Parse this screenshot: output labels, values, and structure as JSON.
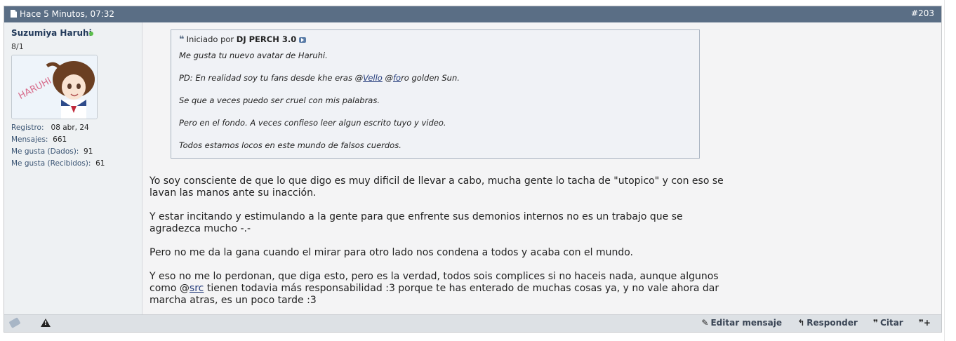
{
  "post": {
    "date": "Hace 5 Minutos, 07:32",
    "number": "#203"
  },
  "user": {
    "name": "Suzumiya Haruhi",
    "title": "8/1",
    "avatar_text": "HARUHI",
    "stats": [
      {
        "label": "Registro:",
        "value": "08 abr, 24"
      },
      {
        "label": "Mensajes:",
        "value": "661"
      },
      {
        "label": "Me gusta (Dados):",
        "value": "91"
      },
      {
        "label": "Me gusta (Recibidos):",
        "value": "61"
      }
    ]
  },
  "quote": {
    "intro": "Iniciado por",
    "author": "DJ PERCH 3.0",
    "line1": "Me gusta tu nuevo avatar de Haruhi.",
    "line2_pre": "PD: En realidad soy tu fans desde khe eras @",
    "line2_link1": "Vello",
    "line2_mid": " @",
    "line2_link2": "fo",
    "line2_link2_tail": "ro",
    "line2_post": " golden Sun.",
    "line3": "Se que a veces puedo ser cruel con mis palabras.",
    "line4": "Pero en el fondo. A veces confieso leer algun escrito tuyo y video.",
    "line5": "Todos estamos locos en este mundo de falsos cuerdos."
  },
  "message": {
    "p1": "Yo soy consciente de que lo que digo es muy dificil de llevar a cabo, mucha gente lo tacha de \"utopico\" y con eso se lavan las manos ante su inacción.",
    "p2": "Y estar incitando y estimulando a la gente para que enfrente sus demonios internos no es un trabajo que se agradezca mucho -.-",
    "p3": "Pero no me da la gana cuando el mirar para otro lado nos condena a todos y acaba con el mundo.",
    "p4_pre": "Y eso no me lo perdonan, que diga esto, pero es la verdad, todos sois complices si no haceis nada, aunque algunos como @",
    "p4_link": "src",
    "p4_post": " tienen todavia más responsabilidad :3 porque te has enterado de muchas cosas ya, y no vale ahora dar marcha atras, es un poco tarde :3"
  },
  "actions": {
    "edit": "Editar mensaje",
    "reply": "Responder",
    "quote": "Citar"
  }
}
